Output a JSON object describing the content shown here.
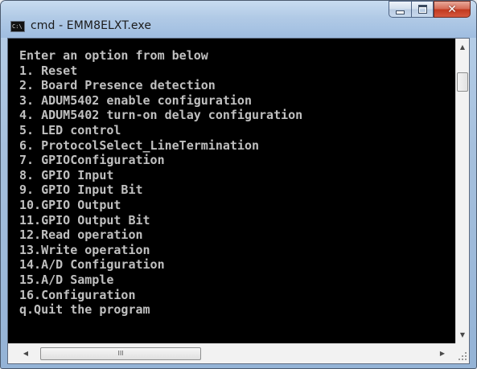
{
  "window": {
    "title": "cmd - EMM8ELXT.exe",
    "icon_text": "C:\\",
    "icon": "console-icon",
    "buttons": [
      "minimize-icon",
      "maximize-icon",
      "close-icon"
    ]
  },
  "console": {
    "lines": [
      "Enter an option from below",
      "1. Reset",
      "2. Board Presence detection",
      "3. ADUM5402 enable configuration",
      "4. ADUM5402 turn-on delay configuration",
      "5. LED control",
      "6. ProtocolSelect_LineTermination",
      "7. GPIOConfiguration",
      "8. GPIO Input",
      "9. GPIO Input Bit",
      "10.GPIO Output",
      "11.GPIO Output Bit",
      "12.Read operation",
      "13.Write operation",
      "14.A/D Configuration",
      "15.A/D Sample",
      "16.Configuration",
      "q.Quit the program"
    ]
  },
  "scrollbars": {
    "up_glyph": "▲",
    "down_glyph": "▼",
    "left_glyph": "◀",
    "right_glyph": "▶",
    "hthumb_grip": "III"
  },
  "colors": {
    "console_bg": "#000000",
    "console_text": "#c0c0c0",
    "close_button": "#c1391f"
  }
}
